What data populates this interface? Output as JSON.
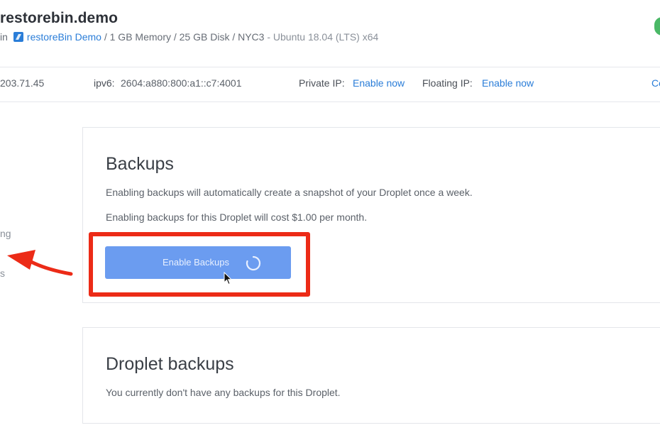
{
  "header": {
    "droplet_name": "restorebin.demo",
    "in_prefix": "in",
    "project_name": "restoreBin Demo",
    "specs": "/ 1 GB Memory / 25 GB Disk / NYC3",
    "os": "- Ubuntu 18.04 (LTS) x64",
    "status_color": "#4ab866"
  },
  "ip_bar": {
    "ipv4_fragment": "203.71.45",
    "ipv6_label": "ipv6:",
    "ipv6_value": "2604:a880:800:a1::c7:4001",
    "private_ip_label": "Private IP:",
    "private_ip_action": "Enable now",
    "floating_ip_label": "Floating IP:",
    "floating_ip_action": "Enable now",
    "right_fragment": "Co"
  },
  "sidebar_fragments": [
    "ng",
    "s"
  ],
  "backups_card": {
    "title": "Backups",
    "description": "Enabling backups will automatically create a snapshot of your Droplet once a week.",
    "cost_text": "Enabling backups for this Droplet will cost $1.00 per month.",
    "button_label": "Enable Backups",
    "button_color": "#6b9cf0"
  },
  "droplet_backups_card": {
    "title": "Droplet backups",
    "empty_text": "You currently don't have any backups for this Droplet."
  },
  "annotation": {
    "highlight_color": "#ec2b17"
  },
  "icons": [
    "project-icon",
    "spinner-icon",
    "cursor-icon",
    "annotation-arrow"
  ]
}
